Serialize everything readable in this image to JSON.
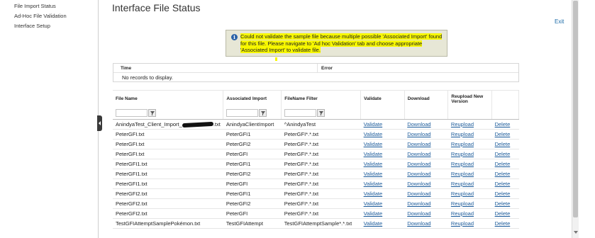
{
  "sidebar": {
    "items": [
      {
        "label": "File Import Status"
      },
      {
        "label": "Ad-Hoc File Validation"
      },
      {
        "label": "Interface Setup"
      }
    ]
  },
  "page": {
    "title": "Interface File Status",
    "exit_label": "Exit"
  },
  "alert": {
    "icon": "info-icon",
    "message": "Could not validate the sample file because multiple possible 'Associated Import' found for this file. Please navigate to 'Ad hoc Validation' tab and choose appropriate 'Associated Import' to validate file."
  },
  "errors": {
    "columns": {
      "time": "Time",
      "error": "Error"
    },
    "empty_text": "No records to display."
  },
  "files_table": {
    "columns": {
      "file_name": "File Name",
      "associated_import": "Associated Import",
      "filename_filter": "FileName Filter",
      "validate": "Validate",
      "download": "Download",
      "reupload": "Reupload New Version"
    },
    "rows": [
      {
        "file_prefix": "AnindyaTest_Client_Import_",
        "file_suffix": ".txt",
        "associated_import": "AnindyaClientImport",
        "filter": "^AnindyaTest",
        "validate": "Validate",
        "download": "Download",
        "reupload": "Reupload",
        "delete": "Delete"
      },
      {
        "file_prefix": "PeterGFI.txt",
        "file_suffix": "",
        "associated_import": "PeterGFI1",
        "filter": "PeterGFI*.*.txt",
        "validate": "Validate",
        "download": "Download",
        "reupload": "Reupload",
        "delete": "Delete"
      },
      {
        "file_prefix": "PeterGFI.txt",
        "file_suffix": "",
        "associated_import": "PeterGFI2",
        "filter": "PeterGFI*.*.txt",
        "validate": "Validate",
        "download": "Download",
        "reupload": "Reupload",
        "delete": "Delete"
      },
      {
        "file_prefix": "PeterGFI.txt",
        "file_suffix": "",
        "associated_import": "PeterGFI",
        "filter": "PeterGFI*.*.txt",
        "validate": "Validate",
        "download": "Download",
        "reupload": "Reupload",
        "delete": "Delete"
      },
      {
        "file_prefix": "PeterGFI1.txt",
        "file_suffix": "",
        "associated_import": "PeterGFI1",
        "filter": "PeterGFI*.*.txt",
        "validate": "Validate",
        "download": "Download",
        "reupload": "Reupload",
        "delete": "Delete"
      },
      {
        "file_prefix": "PeterGFI1.txt",
        "file_suffix": "",
        "associated_import": "PeterGFI2",
        "filter": "PeterGFI*.*.txt",
        "validate": "Validate",
        "download": "Download",
        "reupload": "Reupload",
        "delete": "Delete"
      },
      {
        "file_prefix": "PeterGFI1.txt",
        "file_suffix": "",
        "associated_import": "PeterGFI",
        "filter": "PeterGFI*.*.txt",
        "validate": "Validate",
        "download": "Download",
        "reupload": "Reupload",
        "delete": "Delete"
      },
      {
        "file_prefix": "PeterGFI2.txt",
        "file_suffix": "",
        "associated_import": "PeterGFI1",
        "filter": "PeterGFI*.*.txt",
        "validate": "Validate",
        "download": "Download",
        "reupload": "Reupload",
        "delete": "Delete"
      },
      {
        "file_prefix": "PeterGFI2.txt",
        "file_suffix": "",
        "associated_import": "PeterGFI2",
        "filter": "PeterGFI*.*.txt",
        "validate": "Validate",
        "download": "Download",
        "reupload": "Reupload",
        "delete": "Delete"
      },
      {
        "file_prefix": "PeterGFI2.txt",
        "file_suffix": "",
        "associated_import": "PeterGFI",
        "filter": "PeterGFI*.*.txt",
        "validate": "Validate",
        "download": "Download",
        "reupload": "Reupload",
        "delete": "Delete"
      },
      {
        "file_prefix": "TestGFIAttemptSamplePokémon.txt",
        "file_suffix": "",
        "associated_import": "TestGFIAttempt",
        "filter": "TestGFIAttemptSample*.*.txt",
        "validate": "Validate",
        "download": "Download",
        "reupload": "Reupload",
        "delete": "Delete"
      }
    ]
  },
  "colors": {
    "link": "#1a5a9a",
    "highlight": "#f7f700",
    "alert_bg": "#e7e7d6",
    "info_icon": "#2a62a8"
  }
}
